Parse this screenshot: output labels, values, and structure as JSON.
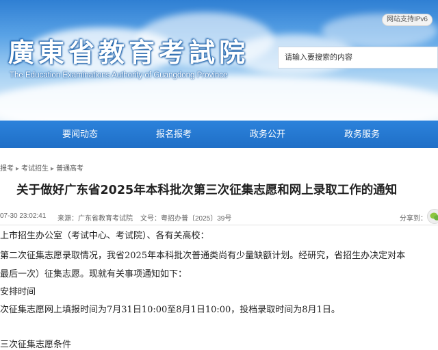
{
  "header": {
    "site_title": "廣東省教育考試院",
    "site_subtitle": "The Education Examinations Authority of Guangdong Province",
    "ipv6_badge": "网站支持IPv6",
    "search_placeholder": "请输入要搜索的内容"
  },
  "nav": {
    "items": [
      "要闻动态",
      "报名报考",
      "政务公开",
      "政务服务"
    ]
  },
  "breadcrumb": {
    "items": [
      "报考",
      "考试招生",
      "普通高考"
    ]
  },
  "article": {
    "title": "关于做好广东省2025年本科批次第三次征集志愿和网上录取工作的通知",
    "date": "07-30 23:02:41",
    "source": "来源：广东省教育考试院",
    "doc_number": "文号：粤招办普〔2025〕39号",
    "share_label": "分享到：",
    "paragraphs": [
      "上市招生办公室（考试中心、考试院）、各有关高校：",
      "第二次征集志愿录取情况，我省2025年本科批次普通类尚有少量缺额计划。经研究，省招生办决定对本",
      "最后一次）征集志愿。现就有关事项通知如下：",
      "安排时间",
      "次征集志愿网上填报时间为7月31日10:00至8月1日10:00，投档录取时间为8月1日。",
      "三次征集志愿条件"
    ]
  },
  "icons": {
    "wechat": "wechat-icon"
  },
  "colors": {
    "nav_blue": "#1f6fc7",
    "banner_blue": "#2f7fd3",
    "text": "#222222"
  }
}
